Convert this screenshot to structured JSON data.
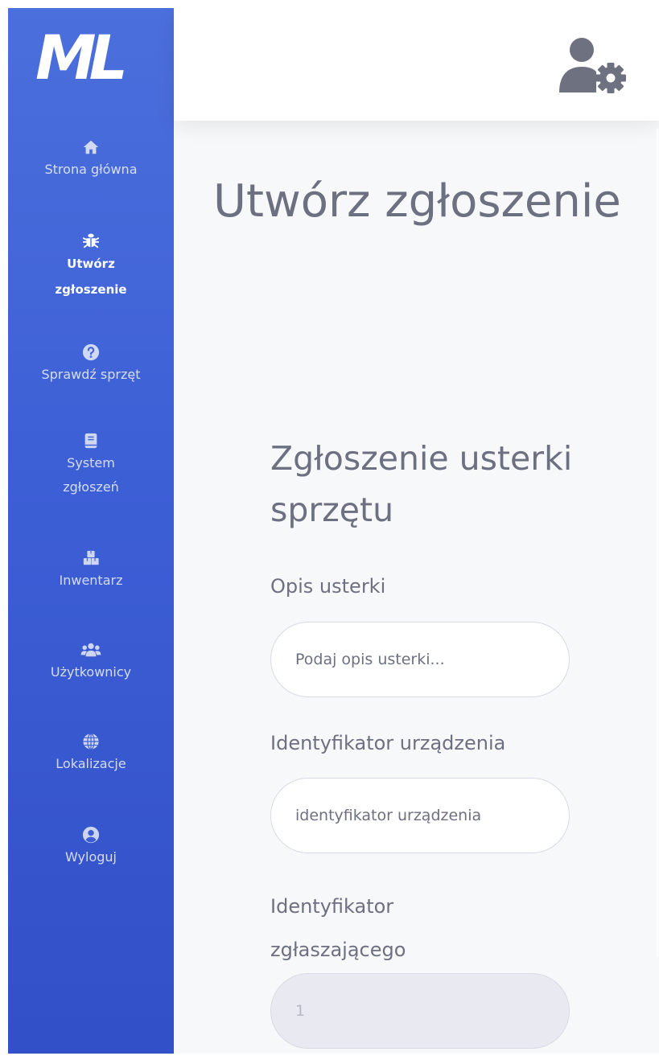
{
  "app": {
    "logo": "ML"
  },
  "sidebar": {
    "items": [
      {
        "label": "Strona główna",
        "icon": "home-icon"
      },
      {
        "label": "Utwórz zgłoszenie",
        "icon": "bug-icon",
        "active": true
      },
      {
        "label": "Sprawdź sprzęt",
        "icon": "question-circle-icon"
      },
      {
        "label": "System zgłoszeń",
        "icon": "book-icon"
      },
      {
        "label": "Inwentarz",
        "icon": "boxes-icon"
      },
      {
        "label": "Użytkownicy",
        "icon": "users-icon"
      },
      {
        "label": "Lokalizacje",
        "icon": "globe-icon"
      },
      {
        "label": "Wyloguj",
        "icon": "user-circle-icon"
      }
    ]
  },
  "header": {
    "user_menu_icon": "user-gear-icon"
  },
  "main": {
    "title": "Utwórz zgłoszenie",
    "form": {
      "title": "Zgłoszenie usterki sprzętu",
      "fields": [
        {
          "label": "Opis usterki",
          "placeholder": "Podaj opis usterki...",
          "value": ""
        },
        {
          "label": "Identyfikator urządzenia",
          "placeholder": "identyfikator urządzenia",
          "value": ""
        },
        {
          "label": "Identyfikator zgłaszającego",
          "placeholder": "",
          "value": "1",
          "disabled": true
        }
      ]
    }
  },
  "colors": {
    "sidebar_top": "#4b6fdc",
    "sidebar_bottom": "#3250c8",
    "text_muted": "#6c7080",
    "content_bg": "#f7f8fa"
  }
}
